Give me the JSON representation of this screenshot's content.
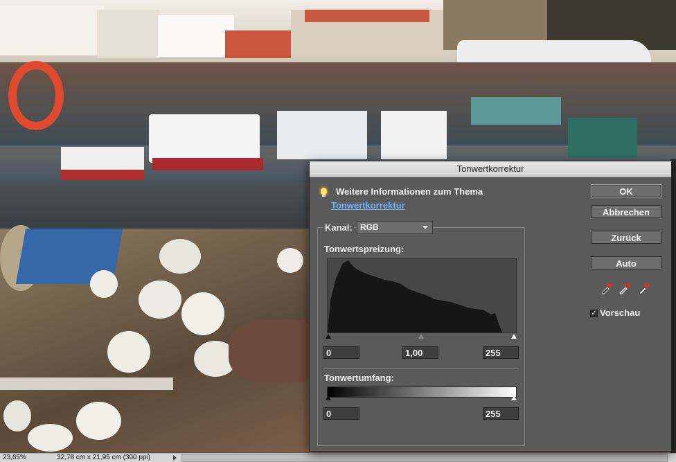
{
  "statusbar": {
    "zoom": "23,65%",
    "document_size": "32,78 cm x 21,95 cm (300 ppi)"
  },
  "dialog": {
    "title": "Tonwertkorrektur",
    "info_title": "Weitere Informationen zum Thema",
    "info_link": "Tonwertkorrektur",
    "channel_label": "Kanal:",
    "channel_value": "RGB",
    "input_levels_label": "Tonwertspreizung:",
    "input_black": "0",
    "input_gamma": "1,00",
    "input_white": "255",
    "output_levels_label": "Tonwertumfang:",
    "output_black": "0",
    "output_white": "255",
    "buttons": {
      "ok": "OK",
      "cancel": "Abbrechen",
      "back": "Zurück",
      "auto": "Auto"
    },
    "preview_label": "Vorschau",
    "preview_checked": true
  },
  "colors": {
    "accent_link": "#6bb5ff",
    "dialog_bg": "#5a5a5a"
  }
}
